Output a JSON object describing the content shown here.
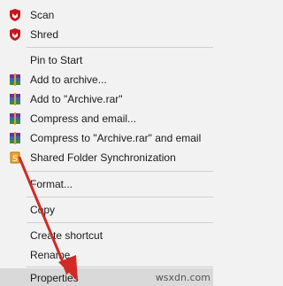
{
  "menu": {
    "items": [
      {
        "label": "Scan",
        "icon": "mcafee-shield-icon"
      },
      {
        "label": "Shred",
        "icon": "mcafee-shield-icon"
      },
      {
        "label": "Pin to Start"
      },
      {
        "label": "Add to archive...",
        "icon": "winrar-books-icon"
      },
      {
        "label": "Add to \"Archive.rar\"",
        "icon": "winrar-books-icon"
      },
      {
        "label": "Compress and email...",
        "icon": "winrar-books-icon"
      },
      {
        "label": "Compress to \"Archive.rar\" and email",
        "icon": "winrar-books-icon"
      },
      {
        "label": "Shared Folder Synchronization",
        "icon": "sync-folder-icon"
      },
      {
        "label": "Format..."
      },
      {
        "label": "Copy"
      },
      {
        "label": "Create shortcut"
      },
      {
        "label": "Rename"
      },
      {
        "label": "Properties"
      }
    ]
  },
  "annotation": {
    "arrow_color": "#d22a24",
    "icon": "red-arrow-pointer"
  },
  "watermark": "wsxdn.com",
  "colors": {
    "mcafee_red": "#c8161d",
    "menu_bg": "#f2f2f2",
    "selected_bg": "#d9d9d9"
  }
}
